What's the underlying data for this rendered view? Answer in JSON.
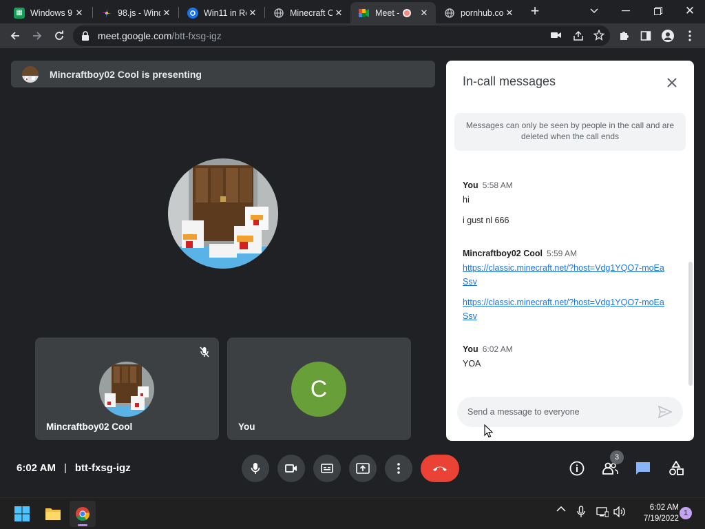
{
  "browser": {
    "tabs": [
      {
        "title": "Windows 9",
        "favicon": "sheets-icon",
        "active": false
      },
      {
        "title": "98.js - Wind",
        "favicon": "pinwheel-icon",
        "active": false
      },
      {
        "title": "Win11 in Re",
        "favicon": "win11-icon",
        "active": false
      },
      {
        "title": "Minecraft C",
        "favicon": "globe-icon",
        "active": false
      },
      {
        "title": "Meet -",
        "favicon": "meet-icon",
        "active": true
      },
      {
        "title": "pornhub.co",
        "favicon": "globe-icon",
        "active": false
      }
    ],
    "url_host": "meet.google.com",
    "url_path": "/btt-fxsg-igz"
  },
  "meet": {
    "presenting_text": "Mincraftboy02 Cool is presenting",
    "tiles": [
      {
        "name": "Mincraftboy02 Cool",
        "muted": true
      },
      {
        "name": "You",
        "letter": "C",
        "color": "#689f38"
      }
    ],
    "time": "6:02 AM",
    "separator": "|",
    "meeting_code": "btt-fxsg-igz",
    "participant_count": "3"
  },
  "chat": {
    "title": "In-call messages",
    "notice": "Messages can only be seen by people in the call and are deleted when the call ends",
    "groups": [
      {
        "sender": "You",
        "time": "5:58 AM",
        "messages": [
          "hi",
          "i gust nl 666"
        ]
      },
      {
        "sender": "Mincraftboy02 Cool",
        "time": "5:59 AM",
        "links": [
          "https://classic.minecraft.net/?host=Vdg1YQO7-moEaSsv",
          "https://classic.minecraft.net/?host=Vdg1YQO7-moEaSsv"
        ]
      },
      {
        "sender": "You",
        "time": "6:02 AM",
        "messages": [
          "YOA"
        ]
      }
    ],
    "input_placeholder": "Send a message to everyone"
  },
  "taskbar": {
    "clock_time": "6:02 AM",
    "clock_date": "7/19/2022",
    "notification_count": "1"
  },
  "colors": {
    "end_call": "#ea4335",
    "chat_active": "#8ab4f8",
    "link": "#1a73e8"
  }
}
